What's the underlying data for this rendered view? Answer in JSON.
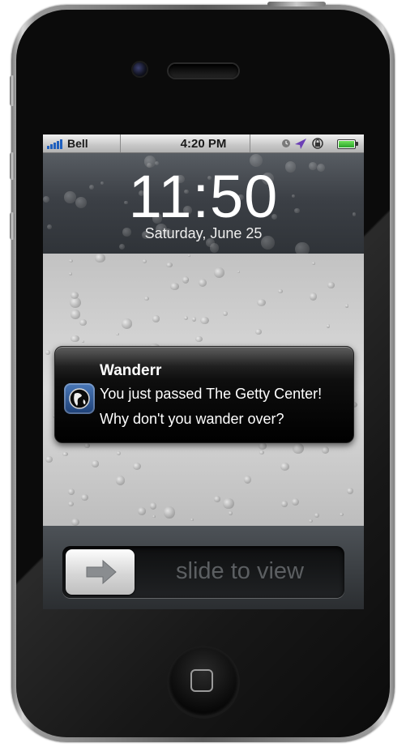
{
  "status_bar": {
    "carrier": "Bell",
    "time": "4:20 PM"
  },
  "lock_screen": {
    "clock": "11:50",
    "date": "Saturday, June 25"
  },
  "notification": {
    "app_name": "Wanderr",
    "message_line1": "You just passed The Getty Center!",
    "message_line2": "Why don't you wander over?"
  },
  "slider": {
    "label": "slide to view"
  },
  "colors": {
    "signal_bars": "#1e5fbe",
    "battery": "#2aa32a",
    "location_arrow": "#6b3fb6"
  }
}
